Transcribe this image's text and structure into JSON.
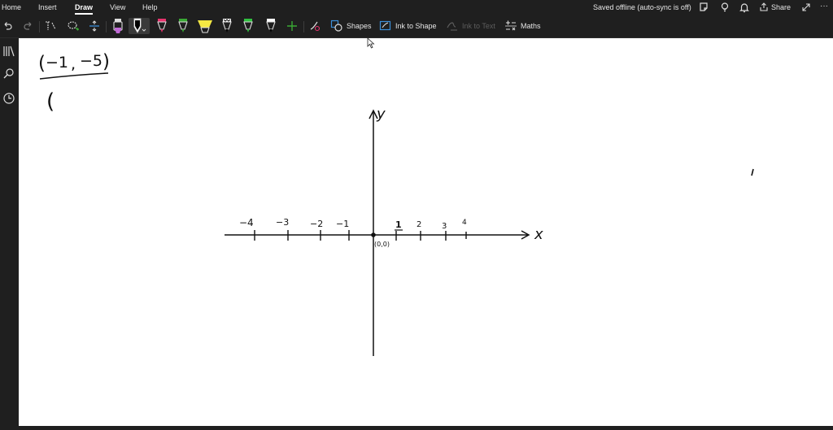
{
  "menu": {
    "items": [
      "Home",
      "Insert",
      "Draw",
      "View",
      "Help"
    ],
    "active": "Draw"
  },
  "status": {
    "text": "Saved offline (auto-sync is off)"
  },
  "share": {
    "label": "Share"
  },
  "toolbar": {
    "shapes_label": "Shapes",
    "ink_to_shape_label": "Ink to Shape",
    "ink_to_text_label": "Ink to Text",
    "maths_label": "Maths"
  },
  "pens": [
    {
      "name": "highlighter-purple",
      "color": "#c06ad6"
    },
    {
      "name": "pen-black-selected",
      "color": "#000000"
    },
    {
      "name": "pen-pink",
      "color": "#e8336e"
    },
    {
      "name": "pen-green",
      "color": "#3aa935"
    },
    {
      "name": "highlighter-yellow",
      "color": "#f5e943"
    },
    {
      "name": "pen-black-galaxy",
      "color": "#000000"
    },
    {
      "name": "pen-green-2",
      "color": "#30c040"
    },
    {
      "name": "pen-black-2",
      "color": "#000000"
    }
  ],
  "handwriting": {
    "point_x": "−1",
    "point_y": "−5",
    "open_paren": "(",
    "y_axis_label": "y",
    "x_axis_label": "x",
    "origin_label": "(0,0)",
    "neg_ticks": [
      "−4",
      "−3",
      "−2",
      "−1"
    ],
    "pos_ticks": [
      "1",
      "2",
      "3",
      "4"
    ]
  }
}
